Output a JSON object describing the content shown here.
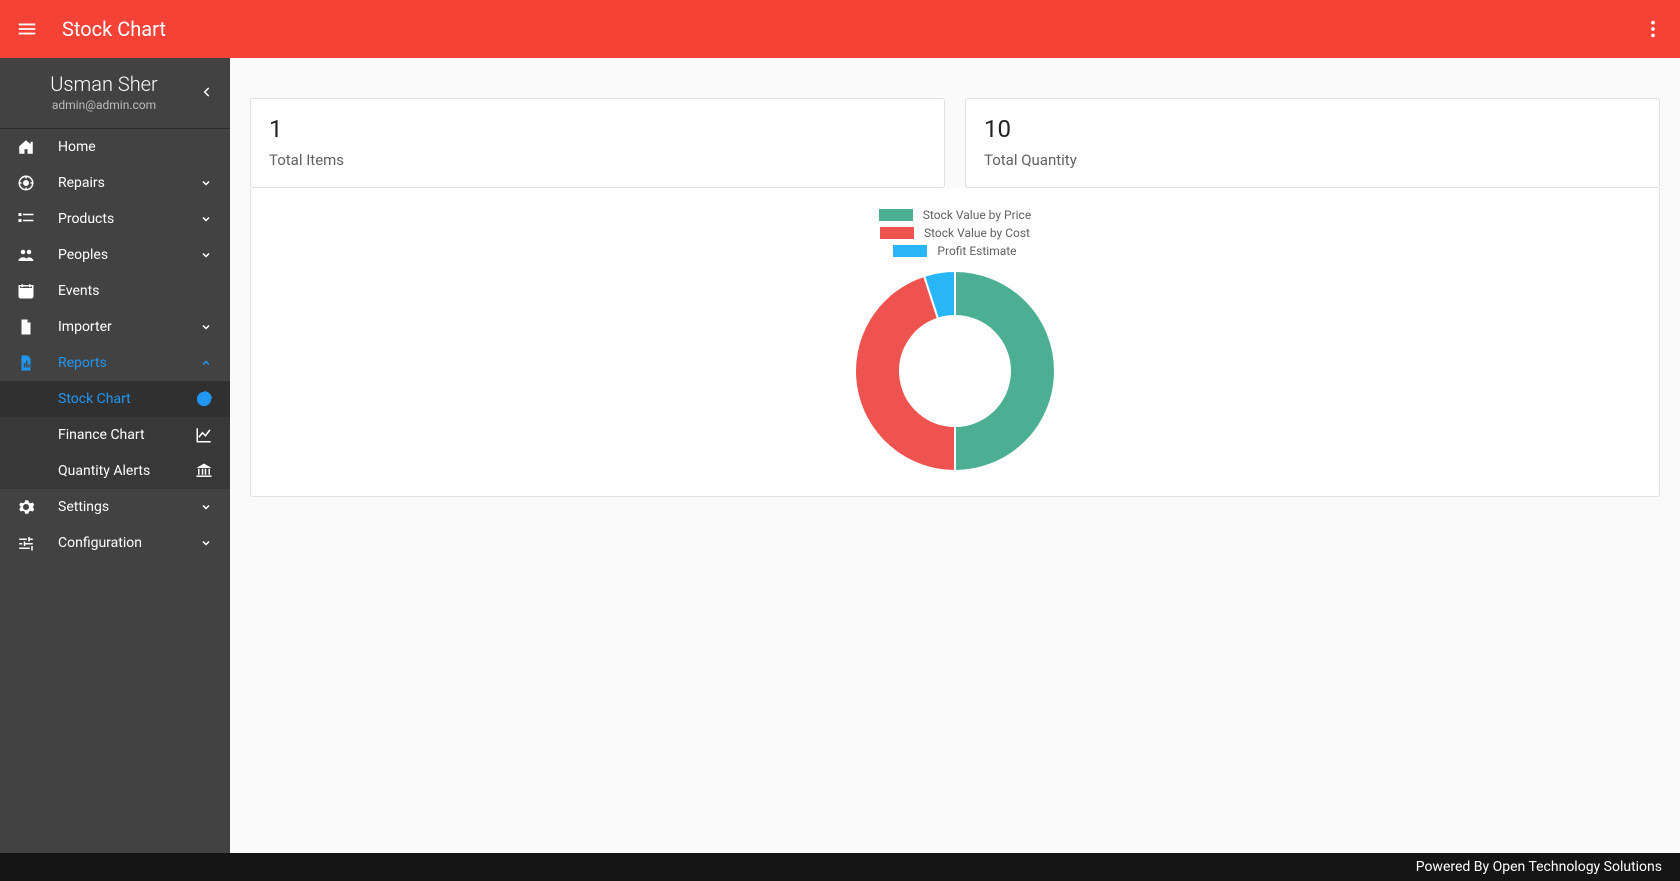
{
  "appbar": {
    "title": "Stock Chart"
  },
  "user": {
    "name": "Usman Sher",
    "email": "admin@admin.com"
  },
  "sidebar": {
    "items": [
      {
        "label": "Home",
        "icon": "home-icon",
        "expandable": false
      },
      {
        "label": "Repairs",
        "icon": "repairs-icon",
        "expandable": true
      },
      {
        "label": "Products",
        "icon": "products-icon",
        "expandable": true
      },
      {
        "label": "Peoples",
        "icon": "people-icon",
        "expandable": true
      },
      {
        "label": "Events",
        "icon": "calendar-icon",
        "expandable": false
      },
      {
        "label": "Importer",
        "icon": "file-icon",
        "expandable": true
      },
      {
        "label": "Reports",
        "icon": "report-icon",
        "expandable": true,
        "active": true,
        "children": [
          {
            "label": "Stock Chart",
            "trail_icon": "donut-icon",
            "active": true
          },
          {
            "label": "Finance Chart",
            "trail_icon": "line-chart-icon"
          },
          {
            "label": "Quantity Alerts",
            "trail_icon": "bank-icon"
          }
        ]
      },
      {
        "label": "Settings",
        "icon": "gear-icon",
        "expandable": true
      },
      {
        "label": "Configuration",
        "icon": "tune-icon",
        "expandable": true
      }
    ]
  },
  "cards": [
    {
      "value": "1",
      "label": "Total Items"
    },
    {
      "value": "10",
      "label": "Total Quantity"
    }
  ],
  "chart_data": {
    "type": "pie",
    "title": "",
    "series": [
      {
        "name": "Stock Value by Price",
        "value": 50,
        "color": "#4caf93"
      },
      {
        "name": "Stock Value by Cost",
        "value": 45,
        "color": "#ef5350"
      },
      {
        "name": "Profit Estimate",
        "value": 5,
        "color": "#29b6f6"
      }
    ]
  },
  "colors": {
    "primary": "#f44336",
    "sidebar": "#424242",
    "accent": "#2196f3"
  },
  "footer": {
    "text": "Powered By Open Technology Solutions"
  }
}
